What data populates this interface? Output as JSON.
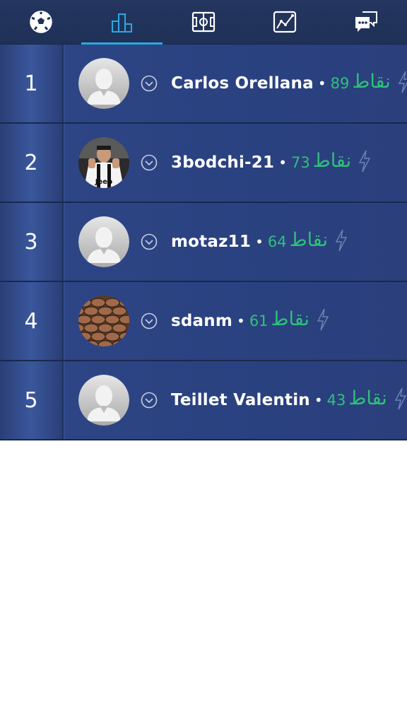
{
  "tabs": [
    {
      "icon": "soccer-ball-icon",
      "active": false
    },
    {
      "icon": "leaderboard-podium-icon",
      "active": true
    },
    {
      "icon": "pitch-field-icon",
      "active": false
    },
    {
      "icon": "stats-chart-icon",
      "active": false
    },
    {
      "icon": "chat-bubbles-icon",
      "active": false
    }
  ],
  "colors": {
    "accent": "#2aa9e0",
    "score_green": "#2fc07a",
    "row_bg": "#2c4583"
  },
  "leaderboard": [
    {
      "rank": "1",
      "name": "Carlos Orellana",
      "separator": "•",
      "score": "89",
      "points_label": "نقاط",
      "avatar": "default-avatar"
    },
    {
      "rank": "2",
      "name": "3bodchi-21",
      "separator": "•",
      "score": "73",
      "points_label": "نقاط",
      "avatar": "player-photo-avatar",
      "avatar_text": "Jeep"
    },
    {
      "rank": "3",
      "name": "motaz11",
      "separator": "•",
      "score": "64",
      "points_label": "نقاط",
      "avatar": "default-avatar"
    },
    {
      "rank": "4",
      "name": "sdanm",
      "separator": "•",
      "score": "61",
      "points_label": "نقاط",
      "avatar": "texture-photo-avatar"
    },
    {
      "rank": "5",
      "name": "Teillet Valentin",
      "separator": "•",
      "score": "43",
      "points_label": "نقاط",
      "avatar": "default-avatar"
    }
  ]
}
